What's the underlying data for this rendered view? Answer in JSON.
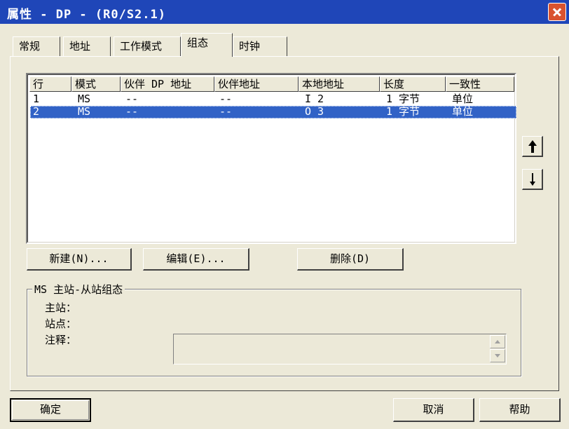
{
  "window": {
    "title": "属性 - DP - (R0/S2.1)"
  },
  "tabs": [
    {
      "label": "常规"
    },
    {
      "label": "地址"
    },
    {
      "label": "工作模式"
    },
    {
      "label": "组态"
    },
    {
      "label": "时钟"
    }
  ],
  "active_tab": "组态",
  "table": {
    "columns": [
      "行",
      "模式",
      "伙伴 DP 地址",
      "伙伴地址",
      "本地地址",
      "长度",
      "一致性"
    ],
    "rows": [
      {
        "row": "1",
        "mode": "MS",
        "partner_dp": "--",
        "partner_addr": "--",
        "local": "I 2",
        "length": "1 字节",
        "consistency": "单位"
      },
      {
        "row": "2",
        "mode": "MS",
        "partner_dp": "--",
        "partner_addr": "--",
        "local": "O 3",
        "length": "1 字节",
        "consistency": "单位"
      }
    ],
    "selected_row": 2
  },
  "buttons": {
    "new": "新建(N)...",
    "edit": "编辑(E)...",
    "delete": "删除(D)",
    "ok": "确定",
    "cancel": "取消",
    "help": "帮助"
  },
  "group": {
    "title": "MS 主站-从站组态",
    "master_label": "主站：",
    "station_label": "站点：",
    "remark_label": "注释："
  },
  "icons": {
    "move_up": "arrow-up-icon",
    "move_down": "arrow-down-icon",
    "close": "close-icon"
  },
  "colors": {
    "title_bar": "#1f46b8",
    "selection": "#3162c6",
    "close_button": "#d9532f",
    "dialog_bg": "#ece9d8"
  }
}
